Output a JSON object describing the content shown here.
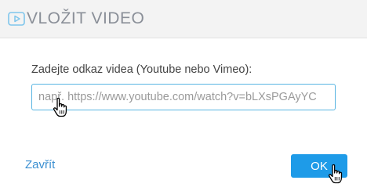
{
  "header": {
    "icon": "video-play-icon",
    "title": "VLOŽIT VIDEO"
  },
  "form": {
    "label": "Zadejte odkaz videa (Youtube nebo Vimeo):",
    "input_value": "",
    "input_placeholder": "např. https://www.youtube.com/watch?v=bLXsPGAyYC"
  },
  "footer": {
    "close_label": "Zavřít",
    "ok_label": "OK"
  },
  "colors": {
    "accent": "#1e9be8",
    "link": "#3a8fd1",
    "header_bg": "#f3f3f3",
    "input_border": "#58b5e2"
  },
  "cursors": [
    "hand-pointer-icon",
    "hand-pointer-icon"
  ]
}
